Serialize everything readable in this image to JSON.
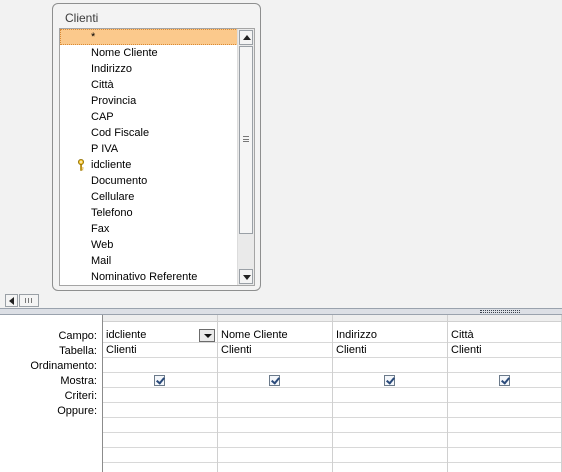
{
  "table": {
    "title": "Clienti",
    "fields": [
      {
        "label": "*",
        "selected": true,
        "key": false
      },
      {
        "label": "Nome Cliente",
        "selected": false,
        "key": false
      },
      {
        "label": "Indirizzo",
        "selected": false,
        "key": false
      },
      {
        "label": "Città",
        "selected": false,
        "key": false
      },
      {
        "label": "Provincia",
        "selected": false,
        "key": false
      },
      {
        "label": "CAP",
        "selected": false,
        "key": false
      },
      {
        "label": "Cod Fiscale",
        "selected": false,
        "key": false
      },
      {
        "label": "P IVA",
        "selected": false,
        "key": false
      },
      {
        "label": "idcliente",
        "selected": false,
        "key": true
      },
      {
        "label": "Documento",
        "selected": false,
        "key": false
      },
      {
        "label": "Cellulare",
        "selected": false,
        "key": false
      },
      {
        "label": "Telefono",
        "selected": false,
        "key": false
      },
      {
        "label": "Fax",
        "selected": false,
        "key": false
      },
      {
        "label": "Web",
        "selected": false,
        "key": false
      },
      {
        "label": "Mail",
        "selected": false,
        "key": false
      },
      {
        "label": "Nominativo Referente",
        "selected": false,
        "key": false
      }
    ]
  },
  "grid": {
    "row_labels": {
      "campo": "Campo:",
      "tabella": "Tabella:",
      "ordinamento": "Ordinamento:",
      "mostra": "Mostra:",
      "criteri": "Criteri:",
      "oppure": "Oppure:"
    },
    "columns": [
      {
        "campo": "idcliente",
        "tabella": "Clienti",
        "mostra": true,
        "has_dropdown": true
      },
      {
        "campo": "Nome Cliente",
        "tabella": "Clienti",
        "mostra": true,
        "has_dropdown": false
      },
      {
        "campo": "Indirizzo",
        "tabella": "Clienti",
        "mostra": true,
        "has_dropdown": false
      },
      {
        "campo": "Città",
        "tabella": "Clienti",
        "mostra": true,
        "has_dropdown": false
      }
    ]
  },
  "icons": {
    "key": "key-icon",
    "scroll_up": "arrow-up-icon",
    "scroll_down": "arrow-down-icon",
    "scroll_left": "arrow-left-icon",
    "dropdown": "chevron-down-icon",
    "check": "checkmark-icon"
  },
  "colors": {
    "selected_field": "#fbc98c",
    "pane_background": "#f2f2f2",
    "splitter": "#dcdfe5"
  }
}
